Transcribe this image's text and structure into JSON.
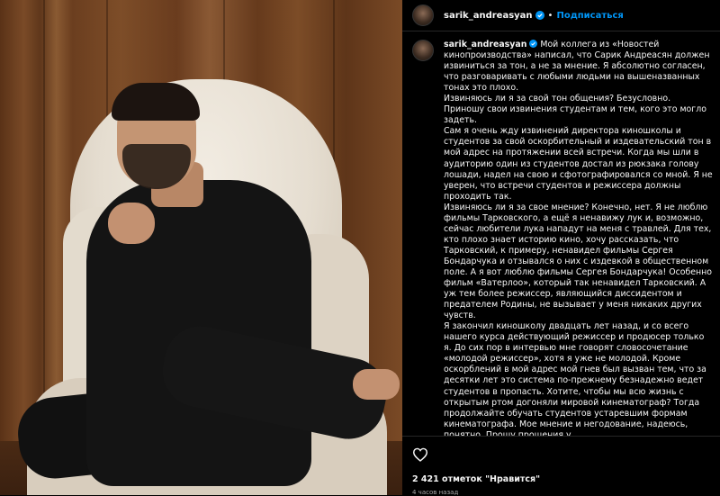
{
  "post": {
    "username": "sarik_andreasyan",
    "follow_label": "Подписаться",
    "separator": "•",
    "more_label": "•••"
  },
  "caption": {
    "username": "sarik_andreasyan",
    "paragraphs": [
      "Мой коллега из «Новостей кинопроизводства» написал, что Сарик Андреасян должен извиниться за тон, а не за мнение. Я абсолютно согласен, что разговаривать с любыми людьми на вышеназванных тонах это плохо.",
      "Извиняюсь ли я за свой тон общения? Безусловно. Приношу свои извинения студентам и тем, кого это могло задеть.",
      "Сам я очень жду извинений директора киношколы и студентов за свой оскорбительный и издевательский тон в мой адрес на протяжении всей встречи. Когда мы шли в аудиторию один из студентов достал из рюкзака голову лошади, надел на свою и сфотографировался со мной. Я не уверен, что встречи студентов и режиссера должны проходить так.",
      "Извиняюсь ли я за свое мнение? Конечно, нет. Я не люблю фильмы Тарковского, а ещё я ненавижу лук и, возможно, сейчас любители лука нападут на меня с травлей. Для тех, кто плохо знает историю кино, хочу рассказать, что Тарковский, к примеру, ненавидел фильмы Сергея Бондарчука и отзывался о них с издевкой в общественном поле. А я вот люблю фильмы Сергея Бондарчука! Особенно фильм «Ватерлоо», который так ненавидел Тарковский. А уж тем более режиссер, являющийся диссидентом и предателем Родины, не вызывает у меня никаких других чувств.",
      "Я закончил киношколу двадцать лет назад, и со всего нашего курса действующий режиссер и продюсер только я. До сих пор в интервью мне говорят словосочетание «молодой режиссер», хотя я уже не молодой. Кроме оскорблений в мой адрес мой гнев был вызван тем, что за десятки лет это система по-прежнему безнадежно ведет студентов в пропасть. Хотите, чтобы мы всю жизнь с открытым ртом догоняли мировой кинематограф? Тогда продолжайте обучать студентов устаревшим формам кинематографа. Мое мнение и негодование, надеюсь, понятно. Прошу прощения у"
    ]
  },
  "stats": {
    "likes_text": "2 421 отметок \"Нравится\"",
    "time_text": "4 часов назад"
  },
  "colors": {
    "accent": "#0095f6",
    "verified": "#0095f6",
    "background": "#000000",
    "text": "#f5f5f5",
    "muted": "#a8a8a8"
  },
  "icons": {
    "verified": "verified-badge-icon",
    "like": "heart-icon",
    "more": "more-options-icon"
  }
}
